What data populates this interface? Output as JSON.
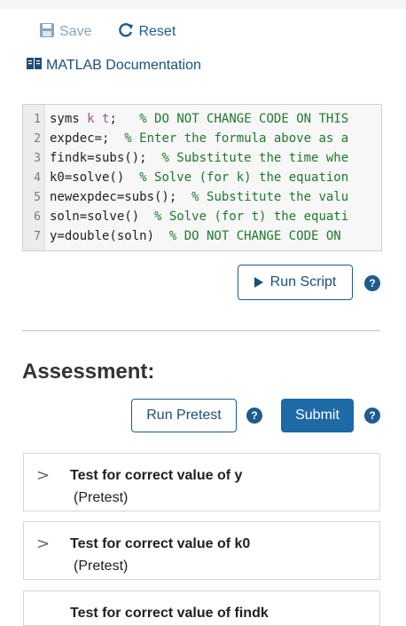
{
  "toolbar": {
    "save_label": "Save",
    "reset_label": "Reset",
    "save_icon": "floppy-disk-icon",
    "reset_icon": "reset-arrow-icon"
  },
  "docs": {
    "label": "MATLAB Documentation",
    "icon": "book-icon"
  },
  "code": {
    "lines": [
      {
        "num": "1",
        "code_a": "syms ",
        "syms_k": "k",
        "code_b": " ",
        "syms_t": "t",
        "code_c": ";   ",
        "comment": "% DO NOT CHANGE CODE ON THIS"
      },
      {
        "num": "2",
        "code": "expdec=;  ",
        "comment": "% Enter the formula above as a"
      },
      {
        "num": "3",
        "code": "findk=subs();  ",
        "comment": "% Substitute the time whe"
      },
      {
        "num": "4",
        "code": "k0=solve()  ",
        "comment": "% Solve (for k) the equation"
      },
      {
        "num": "5",
        "code": "newexpdec=subs();  ",
        "comment": "% Substitute the valu"
      },
      {
        "num": "6",
        "code": "soln=solve()  ",
        "comment": "% Solve (for t) the equati"
      },
      {
        "num": "7",
        "code": "y=double(soln)  ",
        "comment": "% DO NOT CHANGE CODE ON"
      }
    ]
  },
  "run_script": {
    "label": "Run Script",
    "help": "?"
  },
  "assessment": {
    "heading": "Assessment:",
    "run_pretest_label": "Run Pretest",
    "submit_label": "Submit",
    "help": "?"
  },
  "tests": [
    {
      "title": "Test for correct value of y",
      "subtitle": "(Pretest)",
      "chevron": ">"
    },
    {
      "title": "Test for correct value of k0",
      "subtitle": "(Pretest)",
      "chevron": ">"
    },
    {
      "title": "Test for correct value of findk"
    }
  ],
  "colors": {
    "accent": "#1d5c8e",
    "submit_bg": "#1e6aa6",
    "comment": "#1f7a2e",
    "symbol": "#a14fa3"
  }
}
